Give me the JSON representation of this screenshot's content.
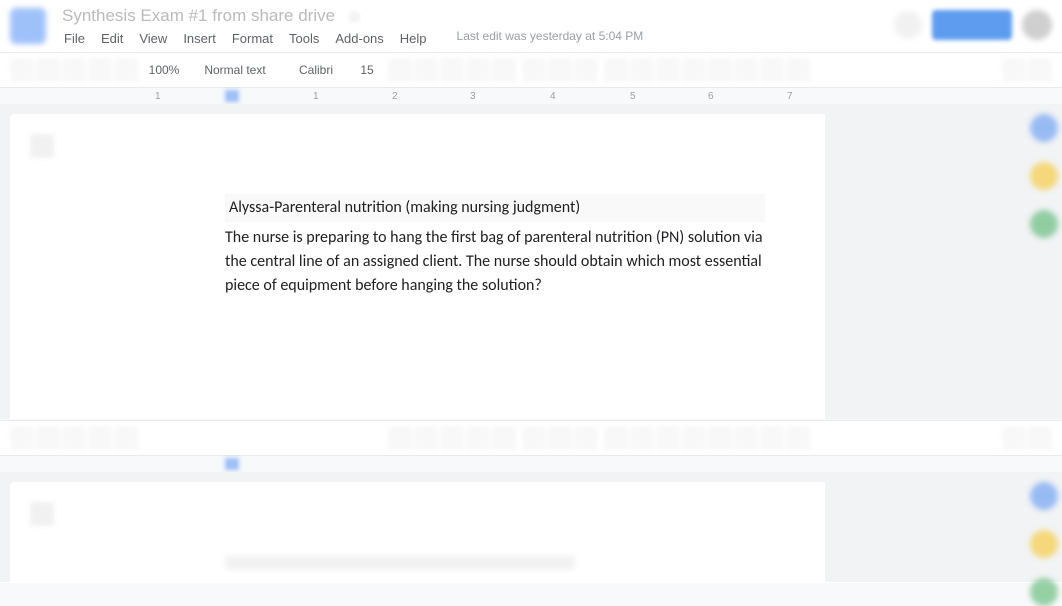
{
  "header": {
    "doc_title": "Synthesis Exam #1 from share drive",
    "menu": {
      "file": "File",
      "edit": "Edit",
      "view": "View",
      "insert": "Insert",
      "format": "Format",
      "tools": "Tools",
      "addons": "Add-ons",
      "help": "Help"
    },
    "last_edit": "Last edit was yesterday at 5:04 PM"
  },
  "toolbar": {
    "zoom": "100%",
    "text_style": "Normal text",
    "font_family": "Calibri",
    "font_size": "15"
  },
  "ruler": {
    "marks": [
      "1",
      "1",
      "2",
      "3",
      "4",
      "5",
      "6",
      "7"
    ]
  },
  "document": {
    "heading": "Alyssa-Parenteral nutrition (making nursing judgment)",
    "body": "The nurse is preparing to hang the first bag of parenteral nutrition (PN) solution via the central line of an assigned client. The nurse should obtain which most essential piece of equipment before hanging the solution?"
  }
}
